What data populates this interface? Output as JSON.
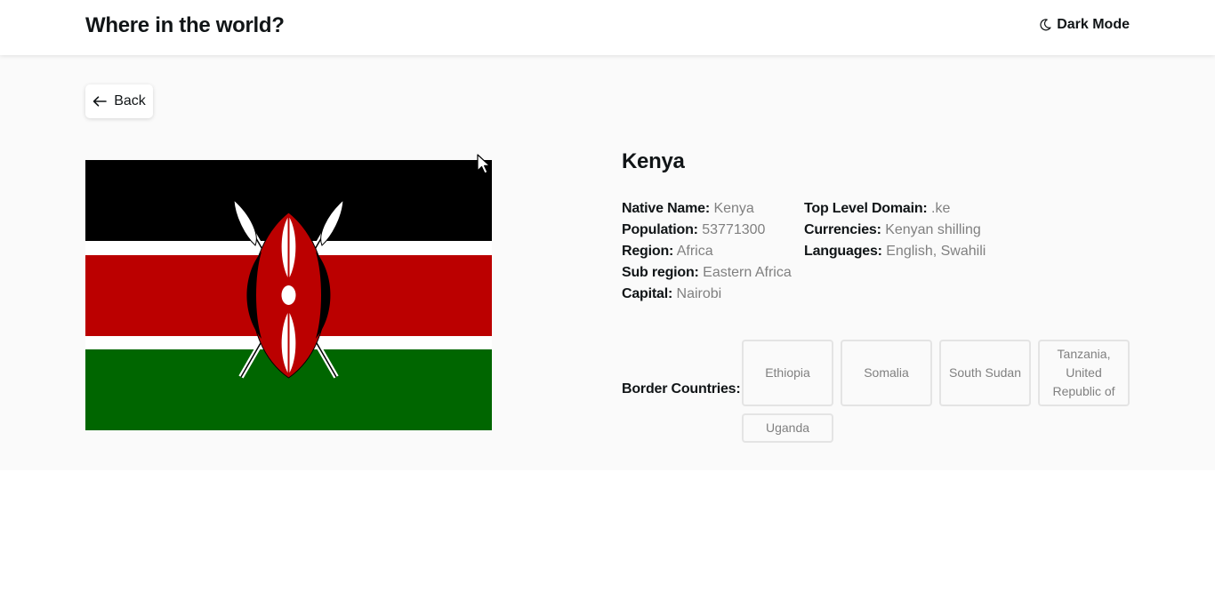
{
  "header": {
    "title": "Where in the world?",
    "dark_mode_label": "Dark Mode",
    "dark_mode_icon": "moon-icon"
  },
  "back_button": {
    "label": "Back",
    "icon": "arrow-left-icon"
  },
  "flag": {
    "icon": "kenya-flag",
    "colors": {
      "black": "#000000",
      "white": "#ffffff",
      "red": "#bb0000",
      "green": "#006600"
    }
  },
  "country": {
    "name": "Kenya",
    "native_name_label": "Native Name:",
    "native_name": "Kenya",
    "population_label": "Population:",
    "population": "53771300",
    "region_label": "Region:",
    "region": "Africa",
    "sub_region_label": "Sub region:",
    "sub_region": "Eastern Africa",
    "capital_label": "Capital:",
    "capital": "Nairobi",
    "tld_label": "Top Level Domain:",
    "tld": ".ke",
    "currencies_label": "Currencies:",
    "currencies": "Kenyan shilling",
    "languages_label": "Languages:",
    "languages": "English, Swahili"
  },
  "borders": {
    "label": "Border Countries:",
    "countries": [
      "Ethiopia",
      "Somalia",
      "South Sudan",
      "Tanzania, United Republic of",
      "Uganda"
    ]
  },
  "colors": {
    "background": "#fafafa",
    "header_bg": "#ffffff",
    "text": "#111517",
    "muted_text": "#808080",
    "tag_border": "#e4e4e4"
  }
}
